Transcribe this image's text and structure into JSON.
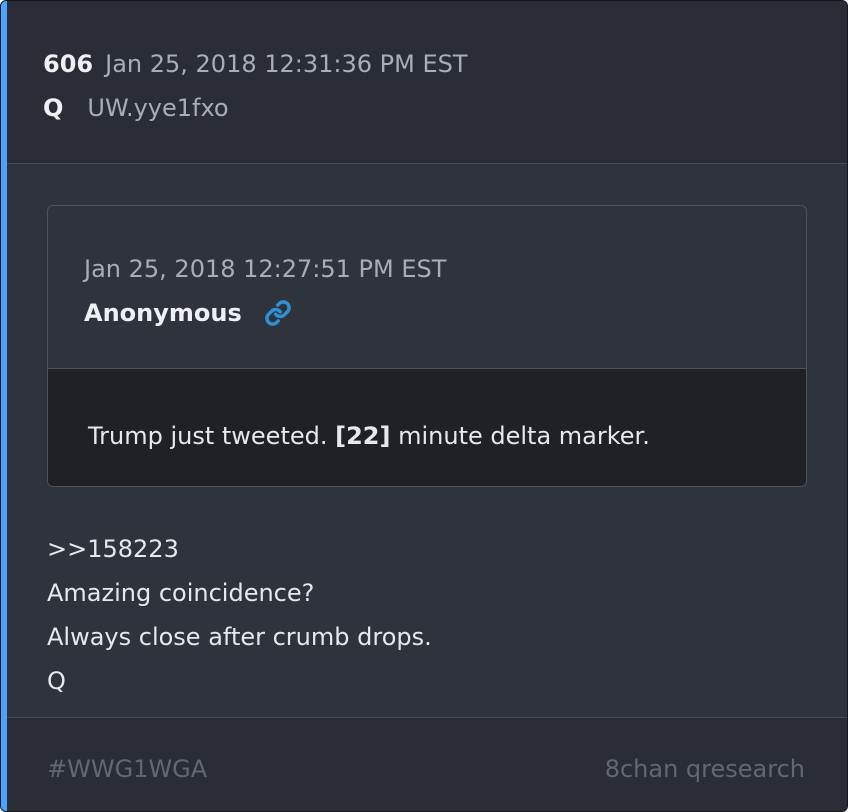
{
  "colors": {
    "card_bg": "#2f333c",
    "header_bg": "#2a2d35",
    "quote_body_bg": "#1f2127",
    "accent": "#4aa3ff",
    "link_icon": "#2f8fd6",
    "muted_text": "#a9adb5",
    "footer_text": "#626771"
  },
  "post": {
    "number": "606",
    "timestamp": "Jan 25, 2018 12:31:36 PM EST",
    "author": "Q",
    "tripcode": "UW.yye1fxo"
  },
  "quoted_post": {
    "timestamp": "Jan 25, 2018 12:27:51 PM EST",
    "author": "Anonymous",
    "link_icon": "link-icon",
    "text_before": "Trump just tweeted. ",
    "text_bold": "[22]",
    "text_after": " minute delta marker."
  },
  "body_lines": [
    ">>158223",
    "Amazing coincidence?",
    "Always close after crumb drops.",
    "Q"
  ],
  "footer": {
    "hashtag": "#WWG1WGA",
    "source": "8chan qresearch"
  }
}
